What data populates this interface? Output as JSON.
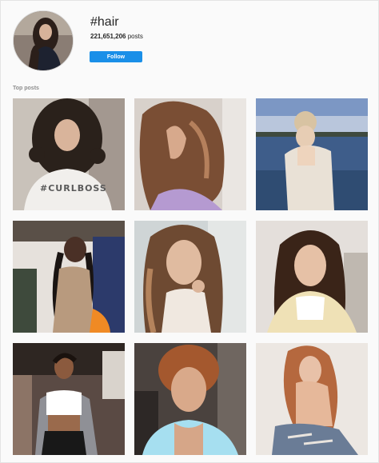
{
  "hashtag": {
    "title": "#hair",
    "posts_count": "221,651,206",
    "posts_suffix": " posts",
    "follow_label": "Follow"
  },
  "section": {
    "label": "Top posts"
  },
  "posts": [
    {
      "name": "post-curly-hair-tshirt",
      "caption": "#CURLBOSS"
    },
    {
      "name": "post-wavy-brown-hair"
    },
    {
      "name": "post-updo-lake"
    },
    {
      "name": "post-braids-car-mirror"
    },
    {
      "name": "post-balayage-hair-car"
    },
    {
      "name": "post-long-dark-hair-sweater"
    },
    {
      "name": "post-ponytail-crop-top"
    },
    {
      "name": "post-short-curly-hair"
    },
    {
      "name": "post-long-wavy-hair-jeans"
    }
  ],
  "colors": {
    "accent": "#1a8fe8",
    "text": "#262626",
    "muted": "#8e8e8e"
  }
}
